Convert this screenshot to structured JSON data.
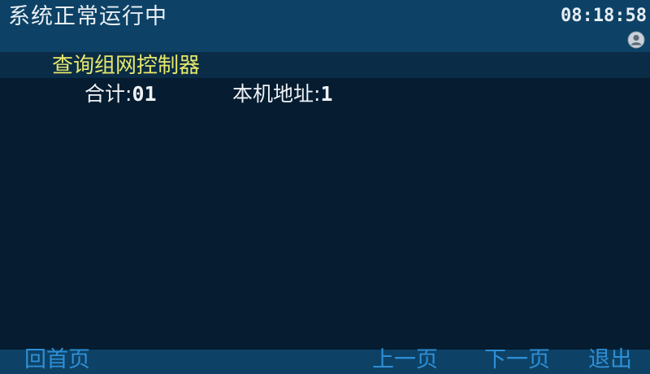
{
  "header": {
    "status": "系统正常运行中",
    "time": "08:18:58",
    "user_icon": "user-circle-icon"
  },
  "panel": {
    "title": "查询组网控制器",
    "total_label": "合计:",
    "total_value": "01",
    "address_label": "本机地址:",
    "address_value": "1"
  },
  "footer": {
    "home": "回首页",
    "prev_page": "上一页",
    "next_page": "下一页",
    "exit": "退出"
  },
  "colors": {
    "background": "#061c30",
    "bar": "#0d4266",
    "title": "#e7e86a",
    "text": "#eef2f6",
    "nav": "#2f8fd6"
  }
}
